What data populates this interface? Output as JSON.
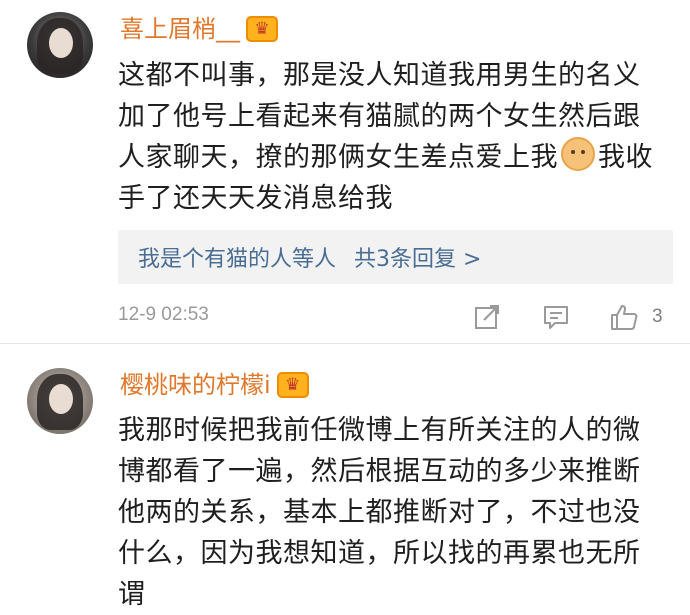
{
  "comments": [
    {
      "username": "喜上眉梢__",
      "badge_icon": "crown-icon",
      "text_line1": "这都不叫事，那是没人知道我用男生的名义",
      "text_line2": "加了他号上看起来有猫腻的两个女生然后跟",
      "text_line3_before": "人家聊天，撩的那俩女生差点爱上我",
      "text_line3_after": "我收",
      "text_line4": "手了还天天发消息给我",
      "emoji": "cat-face-emoji",
      "replies": {
        "name1": "我是个有猫的人",
        "name1_suffix": "等人",
        "count": "共3条回复 >"
      },
      "timestamp": "12-9 02:53",
      "like_count": "3"
    },
    {
      "username": "樱桃味的柠檬i",
      "badge_icon": "crown-icon",
      "text_line1": "我那时候把我前任微博上有所关注的人的微",
      "text_line2": "博都看了一遍，然后根据互动的多少来推断",
      "text_line3": "他两的关系，基本上都推断对了，不过也没",
      "text_line4": "什么，因为我想知道，所以找的再累也无所",
      "text_line5": "谓"
    }
  ],
  "colors": {
    "username": "#e0782b",
    "link": "#4a6d94",
    "meta": "#9a9a9a",
    "reply_bg": "#f2f2f2"
  }
}
